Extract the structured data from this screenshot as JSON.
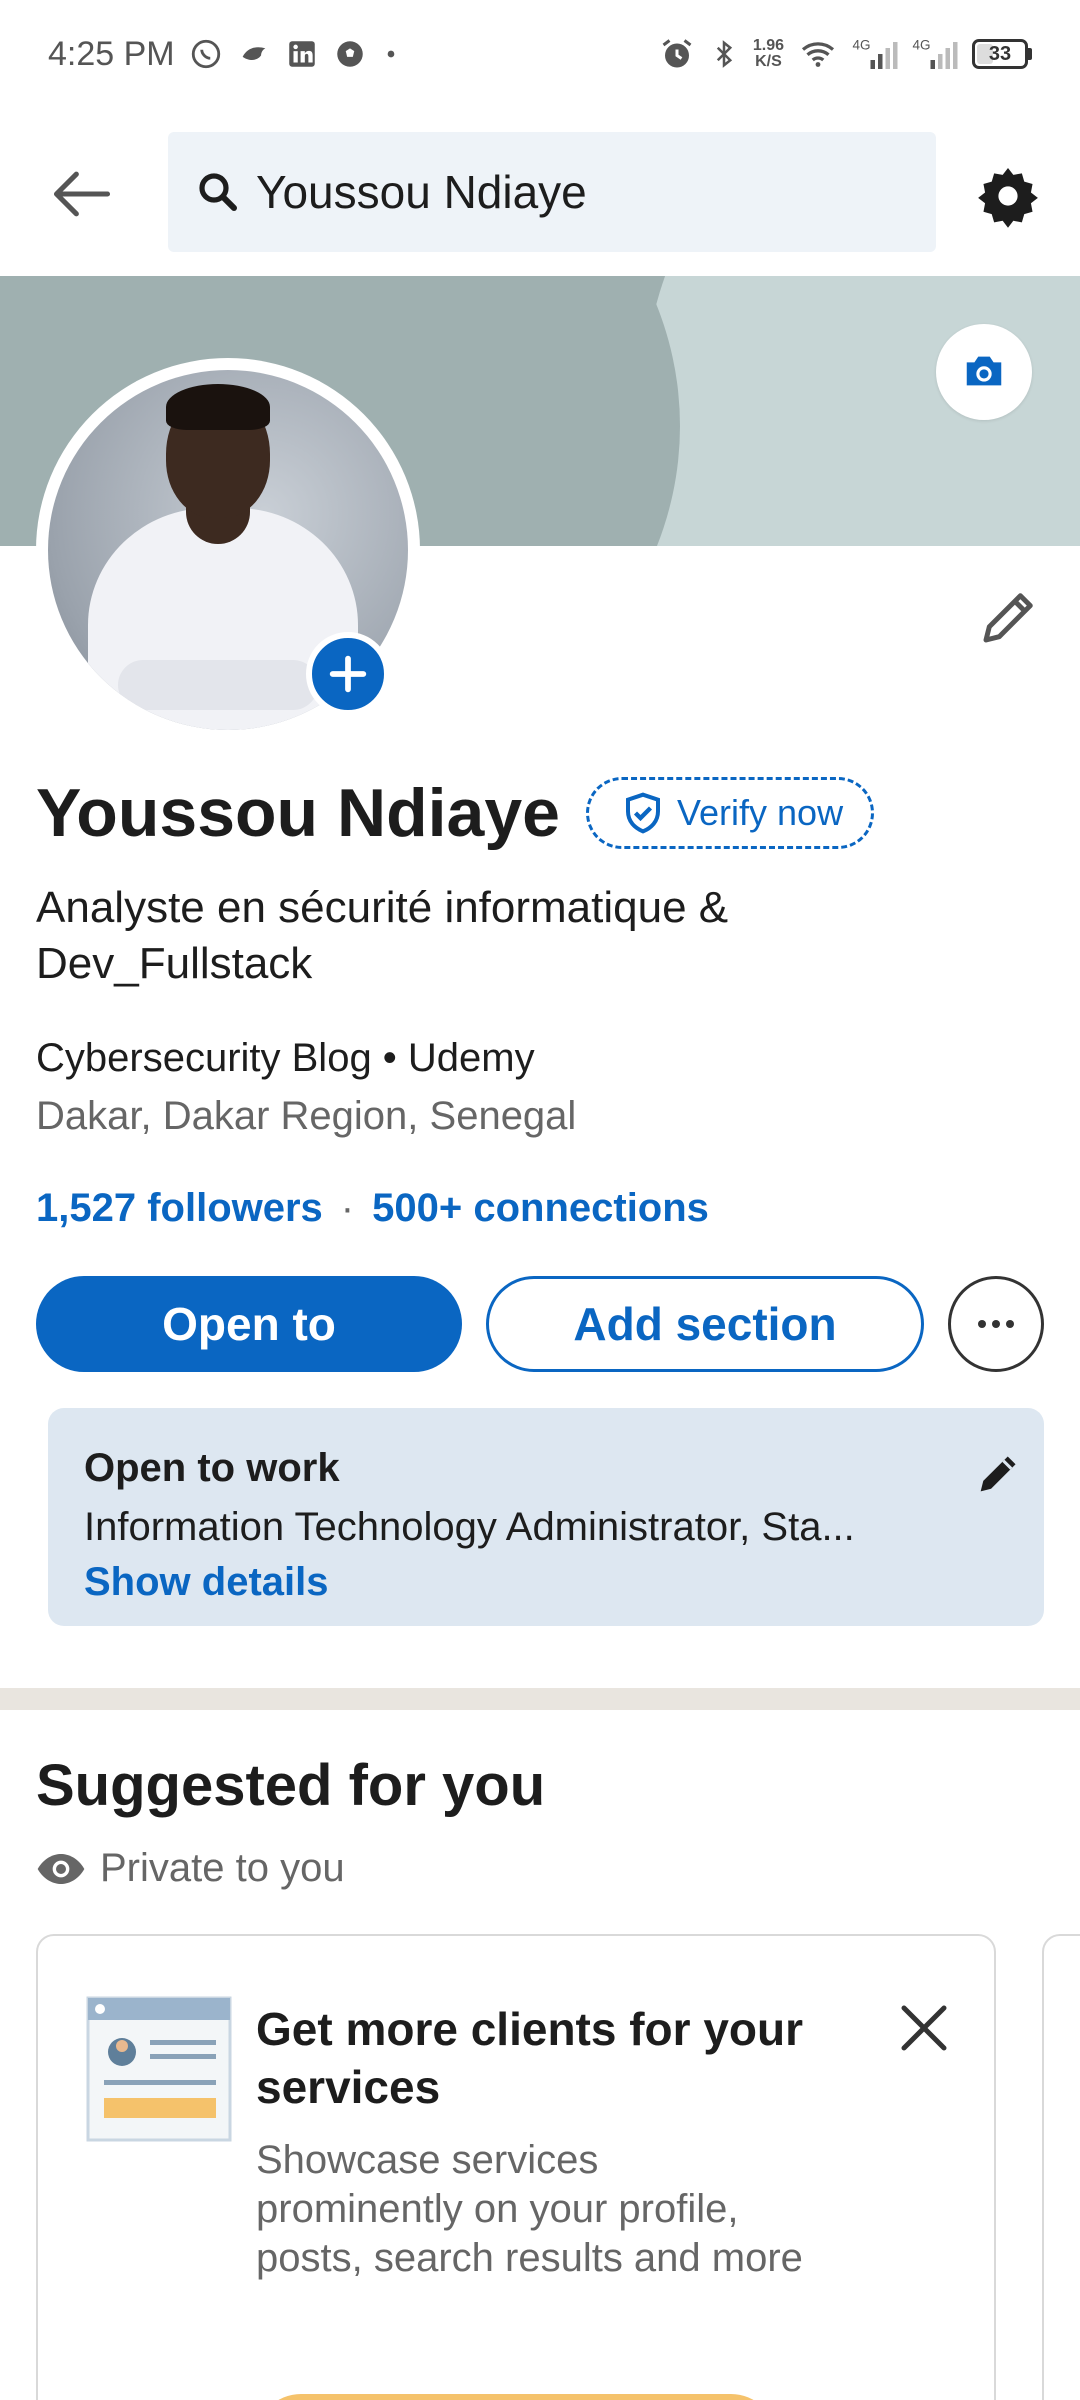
{
  "status_bar": {
    "time": "4:25 PM",
    "speed_value": "1.96",
    "speed_unit": "K/S",
    "network_1": "4G",
    "network_2": "4G",
    "battery": "33"
  },
  "search": {
    "query": "Youssou Ndiaye"
  },
  "profile": {
    "name": "Youssou Ndiaye",
    "verify_label": "Verify now",
    "headline": "Analyste en sécurité informatique & Dev_Fullstack",
    "company": "Cybersecurity Blog • Udemy",
    "location": "Dakar, Dakar Region, Senegal",
    "followers": "1,527 followers",
    "separator": "·",
    "connections": "500+ connections"
  },
  "actions": {
    "open_to": "Open to",
    "add_section": "Add section"
  },
  "open_to_work": {
    "title": "Open to work",
    "description": "Information Technology Administrator, Sta...",
    "link": "Show details"
  },
  "suggested": {
    "title": "Suggested for you",
    "privacy": "Private to you",
    "card_title": "Get more clients for your services",
    "card_desc": "Showcase services prominently on your profile, posts, search results and more"
  },
  "colors": {
    "accent": "#0a66c2",
    "card_bg": "#dde7f1",
    "search_bg": "#eef3f8"
  }
}
